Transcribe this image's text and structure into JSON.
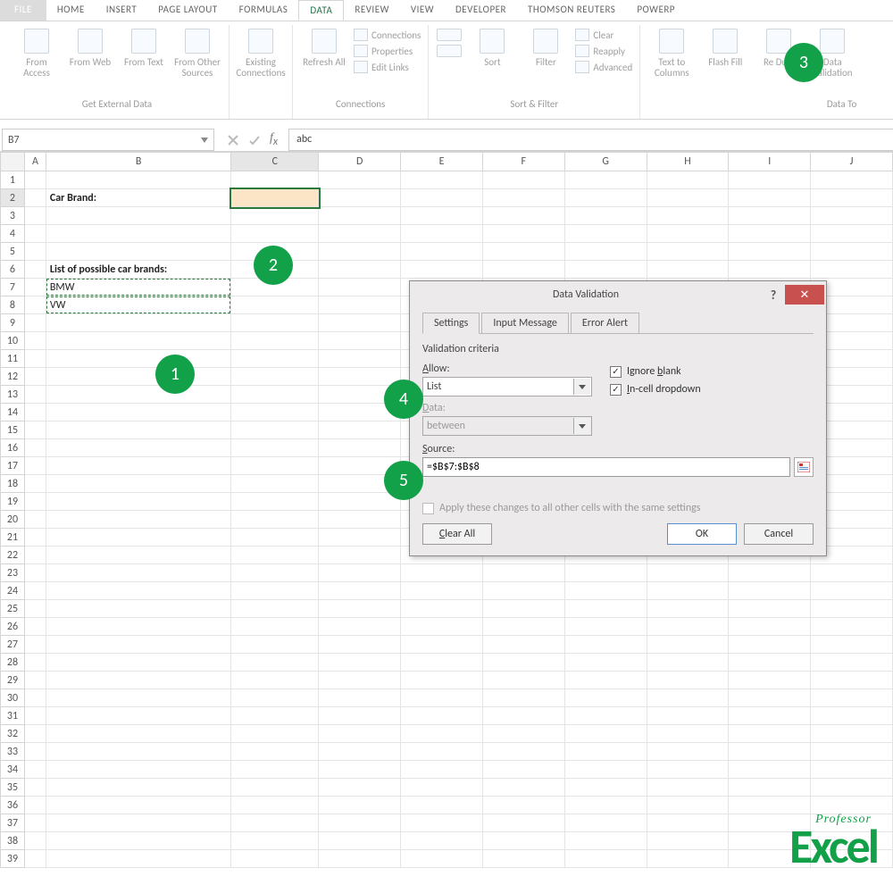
{
  "tabs": {
    "file": "FILE",
    "home": "HOME",
    "insert": "INSERT",
    "pagelayout": "PAGE LAYOUT",
    "formulas": "FORMULAS",
    "data": "DATA",
    "review": "REVIEW",
    "view": "VIEW",
    "developer": "DEVELOPER",
    "thomson": "THOMSON REUTERS",
    "powerp": "POWERP"
  },
  "ribbon": {
    "get_ext": {
      "label": "Get External Data",
      "access": "From Access",
      "web": "From Web",
      "text": "From Text",
      "other": "From Other Sources"
    },
    "existing": "Existing Connections",
    "connections": {
      "label": "Connections",
      "refresh": "Refresh All",
      "conn": "Connections",
      "prop": "Properties",
      "edit": "Edit Links"
    },
    "sortfilter": {
      "label": "Sort & Filter",
      "sort": "Sort",
      "filter": "Filter",
      "clear": "Clear",
      "reapply": "Reapply",
      "advanced": "Advanced"
    },
    "datatools": {
      "label": "Data To",
      "t2c": "Text to Columns",
      "flash": "Flash Fill",
      "dup": "Re Dupl",
      "valid": "Data Validation"
    }
  },
  "namebox": "B7",
  "formula": "abc",
  "cols": [
    "A",
    "B",
    "C",
    "D",
    "E",
    "F",
    "G",
    "H",
    "I",
    "J"
  ],
  "cells": {
    "b2": "Car Brand:",
    "b6": "List of possible car brands:",
    "b7": "BMW",
    "b8": "VW"
  },
  "dialog": {
    "title": "Data Validation",
    "tabs": {
      "settings": "Settings",
      "input": "Input Message",
      "error": "Error Alert"
    },
    "criteria": "Validation criteria",
    "allow_label": "Allow:",
    "allow_value": "List",
    "data_label": "Data:",
    "data_value": "between",
    "ignore": "Ignore blank",
    "incell": "In-cell dropdown",
    "source_label": "Source:",
    "source_value": "=$B$7:$B$8",
    "apply": "Apply these changes to all other cells with the same settings",
    "clear": "Clear All",
    "ok": "OK",
    "cancel": "Cancel"
  },
  "callouts": {
    "c1": "1",
    "c2": "2",
    "c3": "3",
    "c4": "4",
    "c5": "5"
  },
  "logo": {
    "prof": "Professor",
    "excel": "Excel"
  }
}
